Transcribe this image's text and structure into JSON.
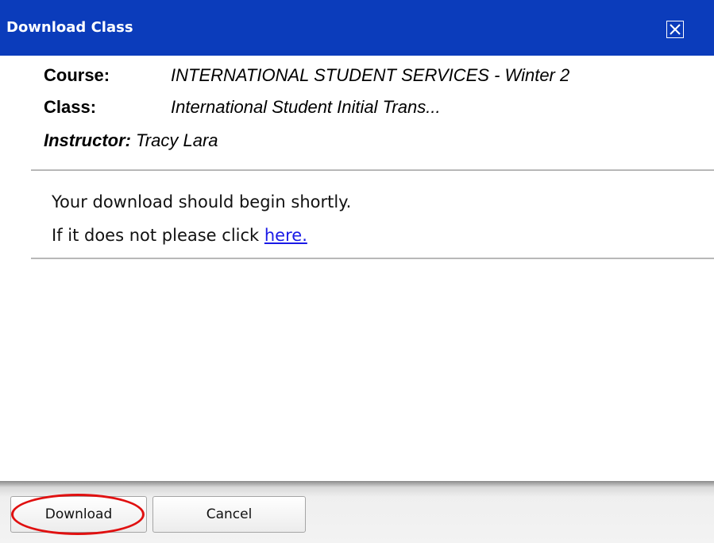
{
  "dialog": {
    "title": "Download Class",
    "close_icon": "close-x-icon"
  },
  "info": {
    "course_label": "Course:",
    "course_value": "INTERNATIONAL STUDENT SERVICES - Winter 2",
    "class_label": "Class:",
    "class_value": "International Student Initial Trans...",
    "instructor_label": "Instructor:",
    "instructor_value": "Tracy Lara"
  },
  "message": {
    "line1": "Your download should begin shortly.",
    "line2_prefix": "If it does not please click ",
    "link_text": "here."
  },
  "footer": {
    "download_label": "Download",
    "cancel_label": "Cancel"
  },
  "colors": {
    "titlebar": "#0b3cbb",
    "link": "#1a1ae6",
    "highlight": "#e01010"
  }
}
